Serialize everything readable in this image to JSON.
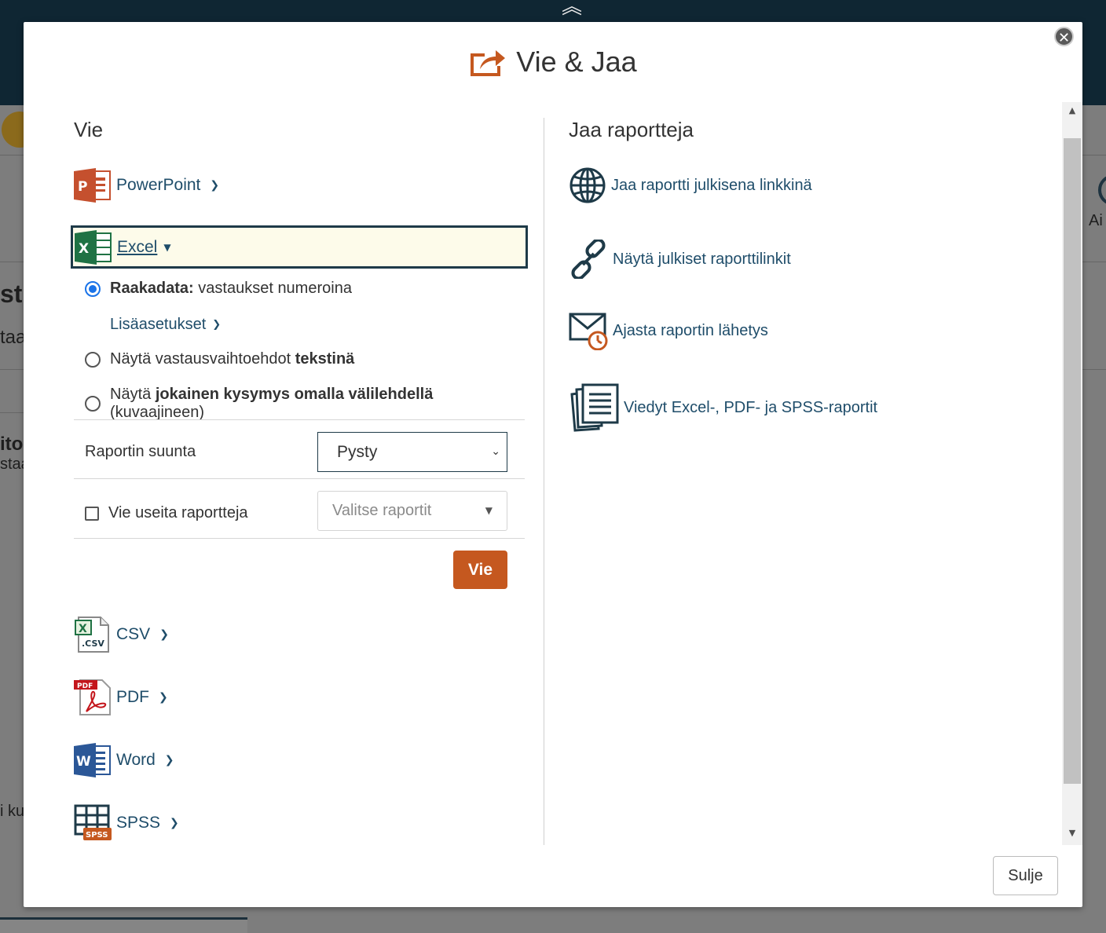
{
  "background": {
    "left_fragments": [
      "sti",
      "taa",
      "ito",
      "staa",
      "i ku"
    ],
    "right_fragment": "Ai"
  },
  "modal": {
    "title": "Vie & Jaa",
    "close_label": "Sulje",
    "export": {
      "heading": "Vie",
      "formats": {
        "powerpoint": "PowerPoint",
        "excel": "Excel",
        "csv": "CSV",
        "pdf": "PDF",
        "word": "Word",
        "spss": "SPSS"
      },
      "excel_options": {
        "raw_label_bold": "Raakadata:",
        "raw_label_rest": " vastaukset numeroina",
        "advanced_link": "Lisäasetukset",
        "text_label_pre": "Näytä vastausvaihtoehdot ",
        "text_label_bold": "tekstinä",
        "tab_label_pre": "Näytä ",
        "tab_label_bold": "jokainen kysymys omalla välilehdellä",
        "tab_label_post": " (kuvaajineen)",
        "selected_option": "raw"
      },
      "orientation_label": "Raportin suunta",
      "orientation_value": "Pysty",
      "multi_label": "Vie useita raportteja",
      "multi_placeholder": "Valitse raportit",
      "multi_checked": false,
      "export_button": "Vie"
    },
    "share": {
      "heading": "Jaa raportteja",
      "items": {
        "public_link": "Jaa raportti julkisena linkkinä",
        "show_links": "Näytä julkiset raporttilinkit",
        "schedule": "Ajasta raportin lähetys",
        "exported": "Viedyt Excel-, PDF- ja SPSS-raportit"
      }
    }
  },
  "colors": {
    "accent": "#c5581f",
    "link": "#1f4d6a",
    "dark": "#1e3a48",
    "highlight": "#fdfbea"
  }
}
